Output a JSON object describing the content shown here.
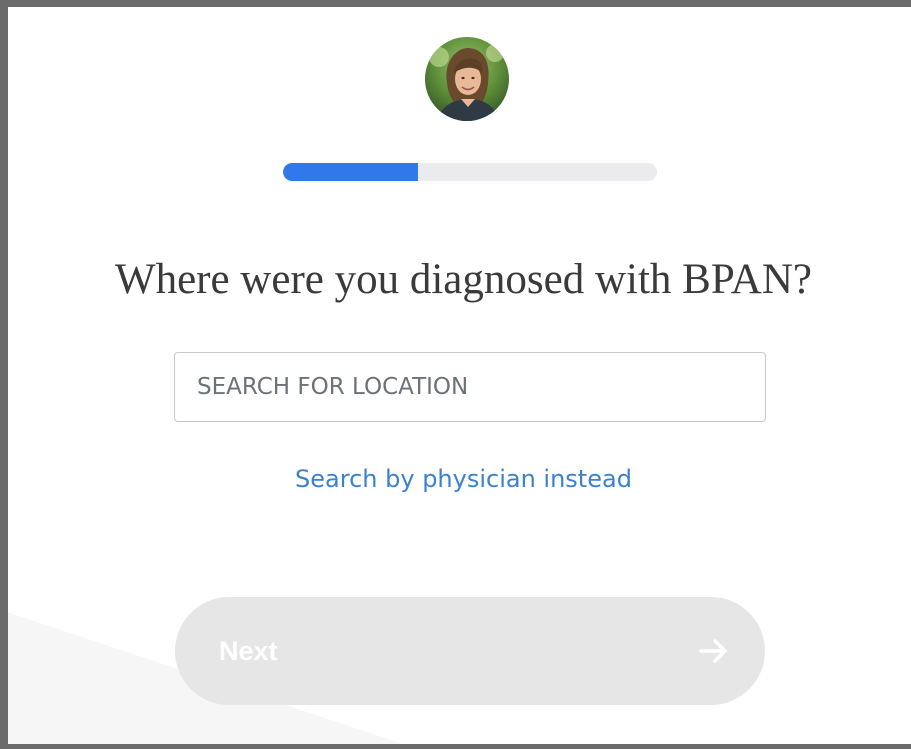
{
  "question": {
    "title": "Where were you diagnosed with BPAN?"
  },
  "progress": {
    "fraction": 0.36
  },
  "search": {
    "placeholder": "SEARCH FOR LOCATION",
    "value": ""
  },
  "alternative_link": {
    "label": "Search by physician instead"
  },
  "next_button": {
    "label": "Next",
    "icon": "arrow-right-icon"
  },
  "avatar": {
    "icon": "user-avatar-photo"
  },
  "colors": {
    "accent": "#2f7ae8",
    "link": "#3a82cf",
    "progress_track": "#ebebef",
    "button_disabled": "#e6e6e7",
    "frame": "#6b6b6b"
  }
}
